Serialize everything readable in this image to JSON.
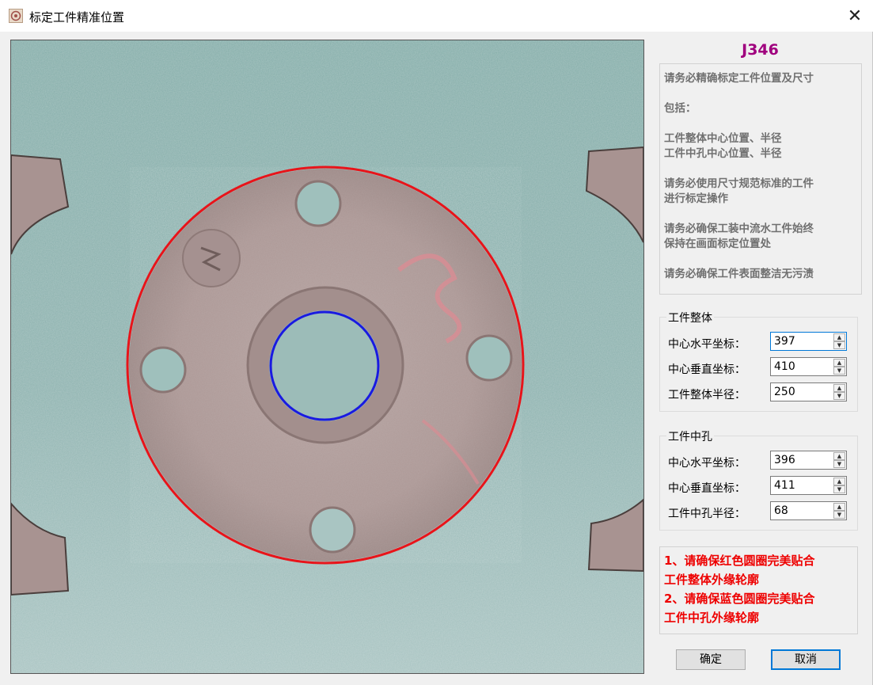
{
  "window": {
    "title": "标定工件精准位置",
    "close_glyph": "✕"
  },
  "job_code": "J346",
  "notes": [
    "请务必精确标定工件位置及尺寸",
    "包括：",
    "工件整体中心位置、半径",
    "工件中孔中心位置、半径",
    "请务必使用尺寸规范标准的工件",
    "进行标定操作",
    "请务必确保工装中流水工件始终",
    "保持在画面标定位置处",
    "请务必确保工件表面整洁无污渍"
  ],
  "whole": {
    "title": "工件整体",
    "center_x_label": "中心水平坐标：",
    "center_x": "397",
    "center_y_label": "中心垂直坐标：",
    "center_y": "410",
    "radius_label": "工件整体半径：",
    "radius": "250"
  },
  "hole": {
    "title": "工件中孔",
    "center_x_label": "中心水平坐标：",
    "center_x": "396",
    "center_y_label": "中心垂直坐标：",
    "center_y": "411",
    "radius_label": "工件中孔半径：",
    "radius": "68"
  },
  "warnings": [
    "1、请确保红色圆圈完美贴合",
    "工件整体外缘轮廓",
    "2、请确保蓝色圆圈完美贴合",
    "工件中孔外缘轮廓"
  ],
  "buttons": {
    "ok": "确定",
    "cancel": "取消"
  },
  "colors": {
    "outer_circle": "#e8141a",
    "hole_circle": "#1a1ae0",
    "job_code": "#a0007e",
    "warning_text": "#ee0000"
  }
}
